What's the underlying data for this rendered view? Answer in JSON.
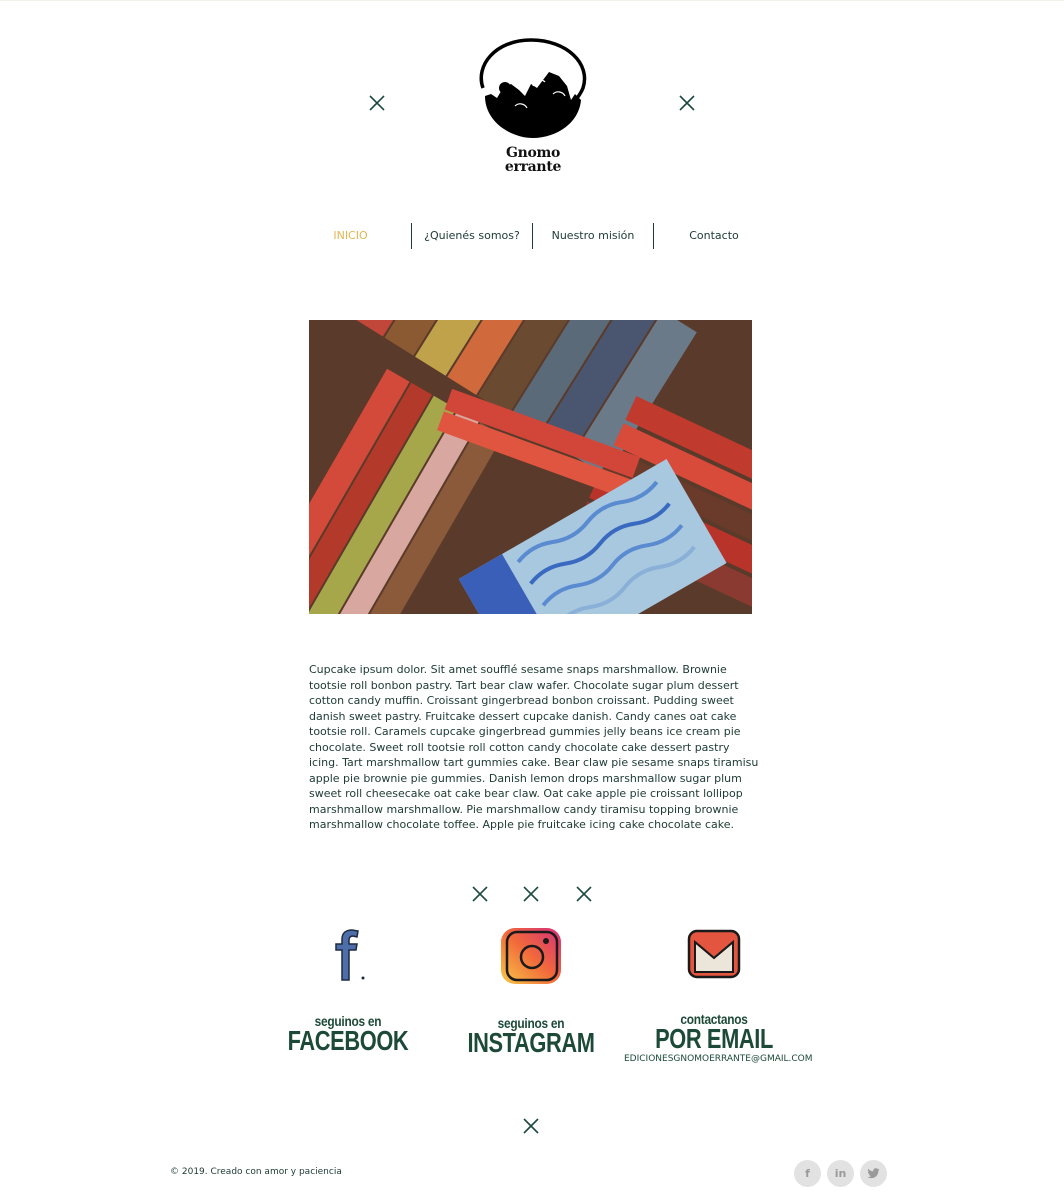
{
  "site": {
    "logo_line1": "Gnomo",
    "logo_line2": "errante"
  },
  "nav": {
    "items": [
      {
        "label": "INICIO",
        "active": true
      },
      {
        "label": "¿Quienés somos?"
      },
      {
        "label": "Nuestro misión"
      },
      {
        "label": "Contacto"
      }
    ]
  },
  "main": {
    "body": "Cupcake ipsum dolor. Sit amet soufflé sesame snaps marshmallow. Brownie tootsie roll bonbon pastry. Tart bear claw wafer. Chocolate sugar plum dessert cotton candy muffin. Croissant gingerbread bonbon croissant. Pudding sweet danish sweet pastry. Fruitcake dessert cupcake danish. Candy canes oat cake tootsie roll. Caramels cupcake gingerbread gummies jelly beans ice cream pie chocolate. Sweet roll tootsie roll cotton candy chocolate cake dessert pastry icing. Tart marshmallow tart gummies cake. Bear claw pie sesame snaps tiramisu apple pie brownie pie gummies. Danish lemon drops marshmallow sugar plum sweet roll cheesecake oat cake bear claw. Oat cake apple pie croissant lollipop marshmallow marshmallow. Pie marshmallow candy tiramisu topping brownie marshmallow chocolate toffee. Apple pie fruitcake icing cake chocolate cake."
  },
  "social": {
    "facebook": {
      "small": "seguinos en",
      "big": "FACEBOOK"
    },
    "instagram": {
      "small": "seguinos en",
      "big": "INSTAGRAM"
    },
    "email": {
      "small": "contactanos",
      "big": "POR EMAIL",
      "address": "EDICIONESGNOMOERRANTE@GMAIL.COM"
    }
  },
  "footer": {
    "copyright": "© 2019. Creado con amor y paciencia",
    "buttons": [
      "f",
      "in",
      "t"
    ]
  },
  "colors": {
    "accent": "#e5b552",
    "text": "#1d3a33",
    "headline": "#1d4a38"
  },
  "icons": [
    "close-icon",
    "facebook-icon",
    "instagram-icon",
    "gmail-icon",
    "linkedin-icon",
    "twitter-icon"
  ]
}
